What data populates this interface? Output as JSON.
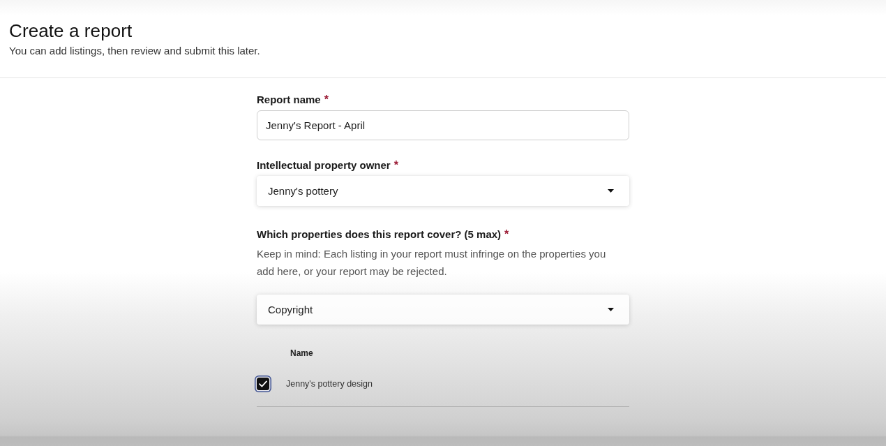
{
  "header": {
    "title": "Create a report",
    "subtitle": "You can add listings, then review and submit this later."
  },
  "form": {
    "fields": [
      {
        "kind": "text",
        "label": "Report name",
        "required_mark": "*",
        "value": "Jenny's Report - April"
      },
      {
        "kind": "select",
        "label": "Intellectual property owner",
        "required_mark": "*",
        "value": "Jenny's pottery"
      },
      {
        "kind": "select",
        "label": "Which properties does this report cover? (5 max)",
        "required_mark": "*",
        "help": "Keep in mind: Each listing in your report must infringe on the properties you add here, or your report may be rejected.",
        "value": "Copyright"
      }
    ]
  },
  "table": {
    "columns": [
      "Name"
    ],
    "rows": [
      {
        "checked": true,
        "focused": true,
        "cells": [
          "Jenny's pottery design"
        ]
      }
    ]
  }
}
